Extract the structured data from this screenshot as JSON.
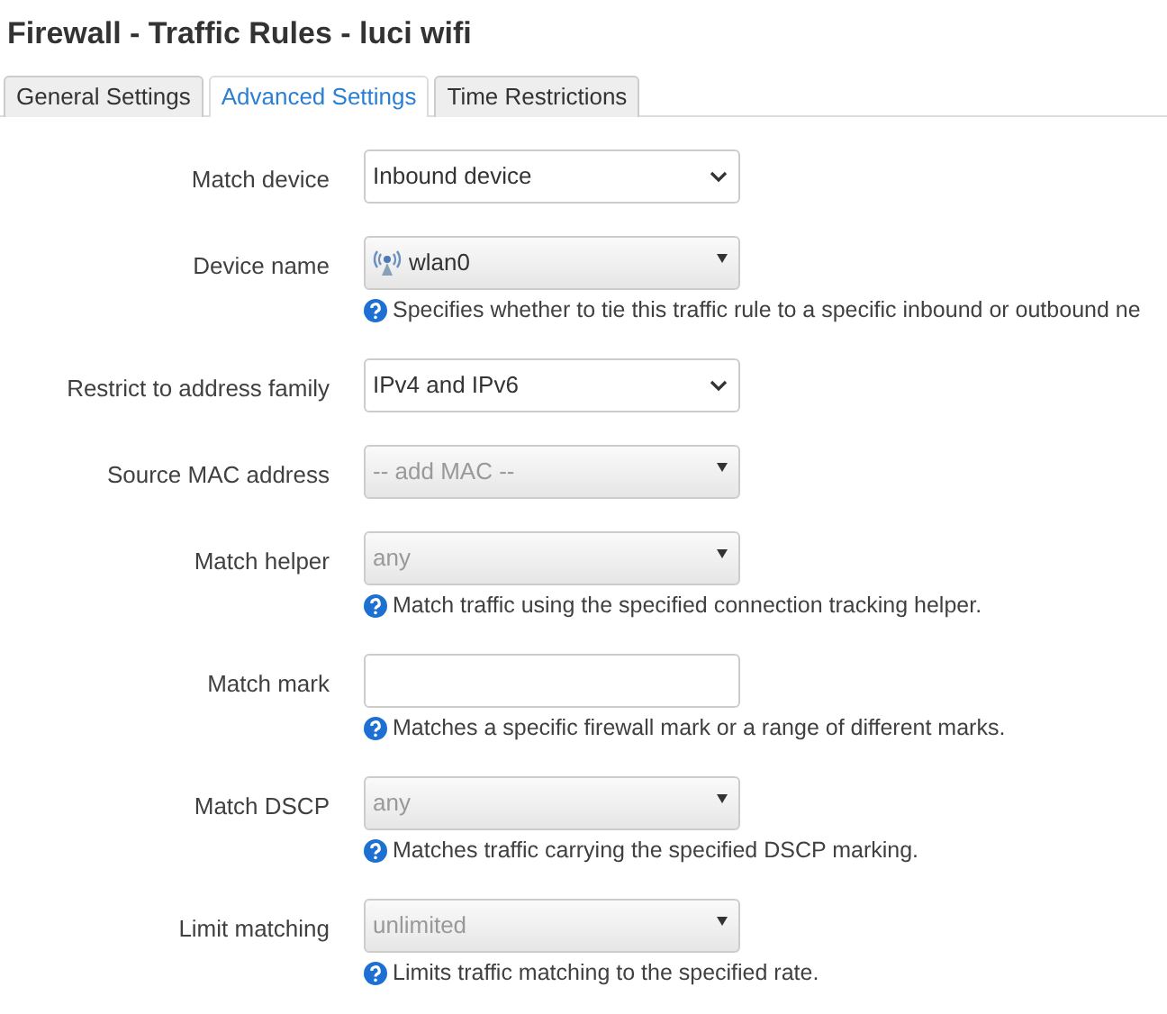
{
  "title": "Firewall - Traffic Rules - luci wifi",
  "tabs": [
    {
      "label": "General Settings",
      "selected": false
    },
    {
      "label": "Advanced Settings",
      "selected": true
    },
    {
      "label": "Time Restrictions",
      "selected": false
    }
  ],
  "fields": [
    {
      "label": "Match device",
      "kind": "select",
      "value": "Inbound device"
    },
    {
      "label": "Device name",
      "kind": "dropdown",
      "value": "wlan0",
      "device_icon": true,
      "help": "Specifies whether to tie this traffic rule to a specific inbound or outbound ne"
    },
    {
      "label": "Restrict to address family",
      "kind": "select",
      "value": "IPv4 and IPv6"
    },
    {
      "label": "Source MAC address",
      "kind": "dropdown",
      "placeholder": "-- add MAC --"
    },
    {
      "label": "Match helper",
      "kind": "dropdown",
      "placeholder": "any",
      "help": "Match traffic using the specified connection tracking helper."
    },
    {
      "label": "Match mark",
      "kind": "text",
      "help": "Matches a specific firewall mark or a range of different marks."
    },
    {
      "label": "Match DSCP",
      "kind": "dropdown",
      "placeholder": "any",
      "help": "Matches traffic carrying the specified DSCP marking."
    },
    {
      "label": "Limit matching",
      "kind": "dropdown",
      "placeholder": "unlimited",
      "help": "Limits traffic matching to the specified rate."
    }
  ]
}
